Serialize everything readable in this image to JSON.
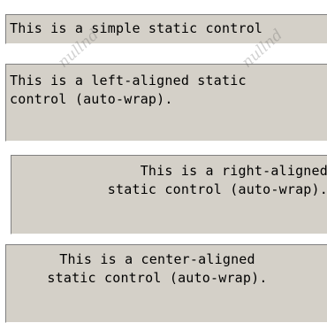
{
  "statics": {
    "simple": "This is a simple static control",
    "left": "This is a left-aligned static\ncontrol (auto-wrap).",
    "right": "This is a right-aligned\nstatic control (auto-wrap).",
    "center": "This is a center-aligned\nstatic control (auto-wrap)."
  },
  "watermark": {
    "text": "nullnd"
  },
  "colors": {
    "control_bg": "#d4d0c8",
    "shadow": "#808080",
    "highlight": "#ffffff",
    "text": "#000000"
  }
}
